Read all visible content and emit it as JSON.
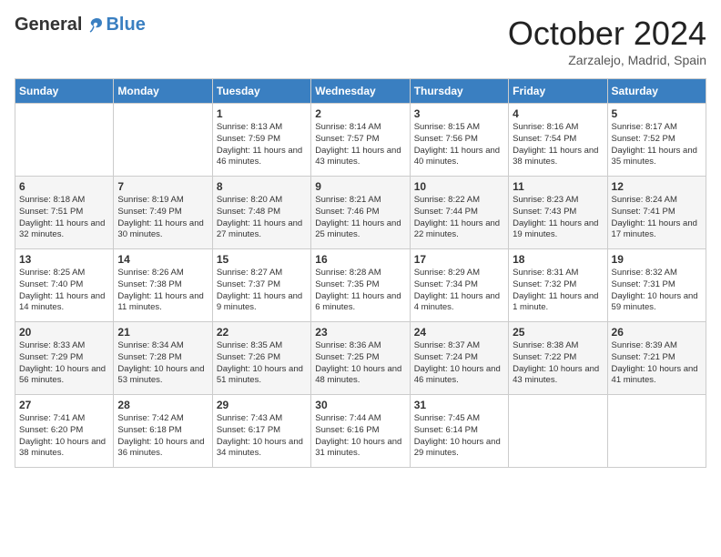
{
  "logo": {
    "general": "General",
    "blue": "Blue"
  },
  "header": {
    "month": "October 2024",
    "location": "Zarzalejo, Madrid, Spain"
  },
  "days_of_week": [
    "Sunday",
    "Monday",
    "Tuesday",
    "Wednesday",
    "Thursday",
    "Friday",
    "Saturday"
  ],
  "weeks": [
    [
      {
        "day": "",
        "info": ""
      },
      {
        "day": "",
        "info": ""
      },
      {
        "day": "1",
        "info": "Sunrise: 8:13 AM\nSunset: 7:59 PM\nDaylight: 11 hours and 46 minutes."
      },
      {
        "day": "2",
        "info": "Sunrise: 8:14 AM\nSunset: 7:57 PM\nDaylight: 11 hours and 43 minutes."
      },
      {
        "day": "3",
        "info": "Sunrise: 8:15 AM\nSunset: 7:56 PM\nDaylight: 11 hours and 40 minutes."
      },
      {
        "day": "4",
        "info": "Sunrise: 8:16 AM\nSunset: 7:54 PM\nDaylight: 11 hours and 38 minutes."
      },
      {
        "day": "5",
        "info": "Sunrise: 8:17 AM\nSunset: 7:52 PM\nDaylight: 11 hours and 35 minutes."
      }
    ],
    [
      {
        "day": "6",
        "info": "Sunrise: 8:18 AM\nSunset: 7:51 PM\nDaylight: 11 hours and 32 minutes."
      },
      {
        "day": "7",
        "info": "Sunrise: 8:19 AM\nSunset: 7:49 PM\nDaylight: 11 hours and 30 minutes."
      },
      {
        "day": "8",
        "info": "Sunrise: 8:20 AM\nSunset: 7:48 PM\nDaylight: 11 hours and 27 minutes."
      },
      {
        "day": "9",
        "info": "Sunrise: 8:21 AM\nSunset: 7:46 PM\nDaylight: 11 hours and 25 minutes."
      },
      {
        "day": "10",
        "info": "Sunrise: 8:22 AM\nSunset: 7:44 PM\nDaylight: 11 hours and 22 minutes."
      },
      {
        "day": "11",
        "info": "Sunrise: 8:23 AM\nSunset: 7:43 PM\nDaylight: 11 hours and 19 minutes."
      },
      {
        "day": "12",
        "info": "Sunrise: 8:24 AM\nSunset: 7:41 PM\nDaylight: 11 hours and 17 minutes."
      }
    ],
    [
      {
        "day": "13",
        "info": "Sunrise: 8:25 AM\nSunset: 7:40 PM\nDaylight: 11 hours and 14 minutes."
      },
      {
        "day": "14",
        "info": "Sunrise: 8:26 AM\nSunset: 7:38 PM\nDaylight: 11 hours and 11 minutes."
      },
      {
        "day": "15",
        "info": "Sunrise: 8:27 AM\nSunset: 7:37 PM\nDaylight: 11 hours and 9 minutes."
      },
      {
        "day": "16",
        "info": "Sunrise: 8:28 AM\nSunset: 7:35 PM\nDaylight: 11 hours and 6 minutes."
      },
      {
        "day": "17",
        "info": "Sunrise: 8:29 AM\nSunset: 7:34 PM\nDaylight: 11 hours and 4 minutes."
      },
      {
        "day": "18",
        "info": "Sunrise: 8:31 AM\nSunset: 7:32 PM\nDaylight: 11 hours and 1 minute."
      },
      {
        "day": "19",
        "info": "Sunrise: 8:32 AM\nSunset: 7:31 PM\nDaylight: 10 hours and 59 minutes."
      }
    ],
    [
      {
        "day": "20",
        "info": "Sunrise: 8:33 AM\nSunset: 7:29 PM\nDaylight: 10 hours and 56 minutes."
      },
      {
        "day": "21",
        "info": "Sunrise: 8:34 AM\nSunset: 7:28 PM\nDaylight: 10 hours and 53 minutes."
      },
      {
        "day": "22",
        "info": "Sunrise: 8:35 AM\nSunset: 7:26 PM\nDaylight: 10 hours and 51 minutes."
      },
      {
        "day": "23",
        "info": "Sunrise: 8:36 AM\nSunset: 7:25 PM\nDaylight: 10 hours and 48 minutes."
      },
      {
        "day": "24",
        "info": "Sunrise: 8:37 AM\nSunset: 7:24 PM\nDaylight: 10 hours and 46 minutes."
      },
      {
        "day": "25",
        "info": "Sunrise: 8:38 AM\nSunset: 7:22 PM\nDaylight: 10 hours and 43 minutes."
      },
      {
        "day": "26",
        "info": "Sunrise: 8:39 AM\nSunset: 7:21 PM\nDaylight: 10 hours and 41 minutes."
      }
    ],
    [
      {
        "day": "27",
        "info": "Sunrise: 7:41 AM\nSunset: 6:20 PM\nDaylight: 10 hours and 38 minutes."
      },
      {
        "day": "28",
        "info": "Sunrise: 7:42 AM\nSunset: 6:18 PM\nDaylight: 10 hours and 36 minutes."
      },
      {
        "day": "29",
        "info": "Sunrise: 7:43 AM\nSunset: 6:17 PM\nDaylight: 10 hours and 34 minutes."
      },
      {
        "day": "30",
        "info": "Sunrise: 7:44 AM\nSunset: 6:16 PM\nDaylight: 10 hours and 31 minutes."
      },
      {
        "day": "31",
        "info": "Sunrise: 7:45 AM\nSunset: 6:14 PM\nDaylight: 10 hours and 29 minutes."
      },
      {
        "day": "",
        "info": ""
      },
      {
        "day": "",
        "info": ""
      }
    ]
  ]
}
